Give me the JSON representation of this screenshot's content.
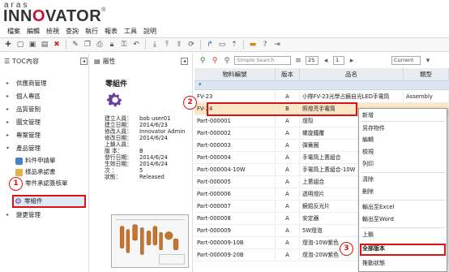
{
  "logo": {
    "small": "aras",
    "big_prefix": "INN",
    "big_red": "O",
    "big_suffix": "VATOR",
    "mark": "®"
  },
  "menu": [
    "檔案",
    "編輯",
    "檢視",
    "查詢",
    "執行",
    "報表",
    "工具",
    "說明"
  ],
  "toc": {
    "title": "TOC內容",
    "items": [
      "供應商管理",
      "個人專區",
      "品質管制",
      "圖文管理",
      "專案管理",
      "產品管理",
      "變更管理"
    ],
    "sub_items": [
      "料件申請單",
      "樣品承認書",
      "零件承認簽核單",
      "零組件"
    ]
  },
  "properties": {
    "header": "屬性",
    "title": "零組件",
    "rows": [
      {
        "k": "建立人員：",
        "v": "bob user01"
      },
      {
        "k": "建立日期：",
        "v": "2014/6/23"
      },
      {
        "k": "修改人員：",
        "v": "Innovator Admin"
      },
      {
        "k": "修改日期：",
        "v": "2014/6/24"
      },
      {
        "k": "上鎖人員：",
        "v": ""
      },
      {
        "k": "版 本：",
        "v": "B"
      },
      {
        "k": "發行日期：",
        "v": "2014/6/24"
      },
      {
        "k": "生效日期：",
        "v": "2014/6/24"
      },
      {
        "k": "次 ：",
        "v": "5"
      },
      {
        "k": "狀態：",
        "v": "Released"
      }
    ]
  },
  "grid_toolbar": {
    "search_mode": "Simple Search",
    "page_size": "25",
    "page": "1",
    "version": "Current"
  },
  "grid": {
    "columns": [
      "物料編號",
      "版本",
      "品名",
      "類型"
    ],
    "rows": [
      [
        "FV-23",
        "A",
        "小隊FV-23光學占鏡自光LED手電筒",
        "Assembly"
      ],
      [
        "FV-24",
        "B",
        "照燈亮手電筒",
        ""
      ],
      [
        "Part-000001",
        "A",
        "燈殼",
        ""
      ],
      [
        "Part-000002",
        "A",
        "螺旋鐵覆",
        ""
      ],
      [
        "Part-000003",
        "A",
        "彈簧圈",
        ""
      ],
      [
        "Part-000004",
        "A",
        "手電筒上蓋組合",
        ""
      ],
      [
        "Part-000004-10W",
        "A",
        "手電筒上蓋組合-10W",
        ""
      ],
      [
        "Part-000005",
        "A",
        "上蓋組合",
        ""
      ],
      [
        "Part-000006",
        "A",
        "透明燈片",
        ""
      ],
      [
        "Part-000007",
        "A",
        "鏡鋁反光片",
        ""
      ],
      [
        "Part-000008",
        "A",
        "安定器",
        ""
      ],
      [
        "Part-000009",
        "A",
        "5W燈泡",
        ""
      ],
      [
        "Part-000009-10B",
        "A",
        "燈泡-10W紫色",
        ""
      ],
      [
        "Part-000009-20B",
        "A",
        "燈泡-20W紫色",
        ""
      ]
    ]
  },
  "context_menu": [
    "新增",
    "另存物件",
    "編輯",
    "檢視",
    "列印",
    "清除",
    "刪除",
    "輸出至Excel",
    "輸出至Word",
    "上鎖",
    "全部版本",
    "推動狀態"
  ],
  "callouts": [
    "1",
    "2",
    "3"
  ]
}
